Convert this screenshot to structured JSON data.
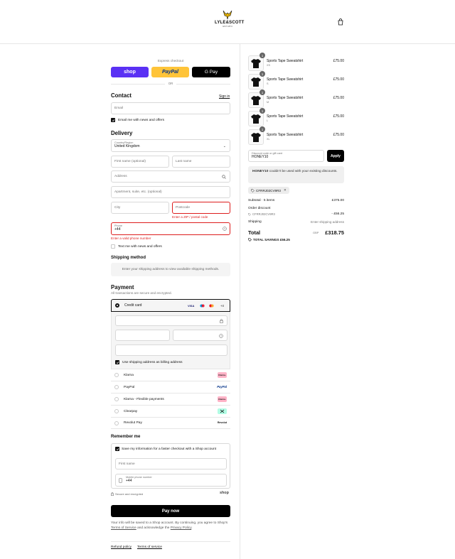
{
  "header": {
    "brand": "LYLE&SCOTT",
    "brand_sub": "EST 1874",
    "cart_icon": "shopping-bag-icon"
  },
  "express": {
    "title": "Express checkout",
    "shop_label": "shop",
    "paypal_label": "PayPal",
    "gpay_label": "G Pay",
    "or": "OR"
  },
  "contact": {
    "heading": "Contact",
    "signin": "Sign in",
    "email_placeholder": "Email",
    "newsletter": "Email me with news and offers"
  },
  "delivery": {
    "heading": "Delivery",
    "country_label": "Country/Region",
    "country_value": "United Kingdom",
    "first_name": "First name (optional)",
    "last_name": "Last name",
    "address": "Address",
    "apartment": "Apartment, suite, etc. (optional)",
    "city": "City",
    "postcode": "Postcode",
    "postcode_error": "Enter a ZIP / postal code",
    "phone_label": "Phone",
    "phone_value": "+44",
    "phone_error": "Enter a valid phone number",
    "text_offers": "Text me with news and offers"
  },
  "shipping": {
    "heading": "Shipping method",
    "info": "Enter your shipping address to view available shipping methods."
  },
  "payment": {
    "heading": "Payment",
    "subtitle": "All transactions are secure and encrypted.",
    "credit_card": "Credit card",
    "card_brands": [
      "VISA",
      "+4"
    ],
    "billing_same": "Use shipping address as billing address",
    "methods": [
      {
        "label": "Klarna",
        "badge": "Klarna."
      },
      {
        "label": "PayPal",
        "badge": "PayPal"
      },
      {
        "label": "Klarna - Flexible payments",
        "badge": "Klarna."
      },
      {
        "label": "Clearpay",
        "badge": ""
      },
      {
        "label": "Revolut Pay",
        "badge": "Revolut"
      }
    ]
  },
  "remember": {
    "heading": "Remember me",
    "save_info": "Save my information for a faster checkout with a Shop account",
    "first_name": "First name",
    "mobile_label": "Mobile phone number",
    "mobile_value": "+44",
    "secure": "Secure and encrypted",
    "shop": "shop"
  },
  "pay_button": "Pay now",
  "legal": {
    "prefix": "Your info will be saved to a Shop account. By continuing, you agree to Shop's",
    "terms": "Terms of Service",
    "middle": "and acknowledge the",
    "privacy": "Privacy Policy",
    "suffix": "."
  },
  "footer": {
    "refund": "Refund policy",
    "terms": "Terms of service"
  },
  "cart": {
    "items": [
      {
        "name": "Sports Tape Sweatshirt",
        "size": "XS",
        "qty": "1",
        "price": "£75.00"
      },
      {
        "name": "Sports Tape Sweatshirt",
        "size": "S",
        "qty": "1",
        "price": "£75.00"
      },
      {
        "name": "Sports Tape Sweatshirt",
        "size": "M",
        "qty": "1",
        "price": "£75.00"
      },
      {
        "name": "Sports Tape Sweatshirt",
        "size": "L",
        "qty": "1",
        "price": "£75.00"
      },
      {
        "name": "Sports Tape Sweatshirt",
        "size": "XL",
        "qty": "1",
        "price": "£75.00"
      }
    ],
    "discount_label": "Discount code or gift card",
    "discount_value": "HONEY10",
    "apply": "Apply",
    "discount_warning_code": "HONEY10",
    "discount_warning_text": "couldn't be used with your existing discounts.",
    "applied_code": "CFRRJ02CV9R3",
    "subtotal_label": "Subtotal · 5 items",
    "subtotal_value": "£375.00",
    "order_discount_label": "Order discount",
    "order_discount_code": "CFRRJ02CV9R3",
    "order_discount_value": "- £56.25",
    "shipping_label": "Shipping",
    "shipping_value": "Enter shipping address",
    "total_label": "Total",
    "currency": "GBP",
    "total_value": "£318.75",
    "savings_label": "TOTAL SAVINGS",
    "savings_value": "£56.25"
  },
  "colors": {
    "shop": "#5a31f4",
    "paypal": "#ffc439",
    "gpay": "#000000",
    "error": "#dd1d1d",
    "pay_button": "#000000"
  }
}
